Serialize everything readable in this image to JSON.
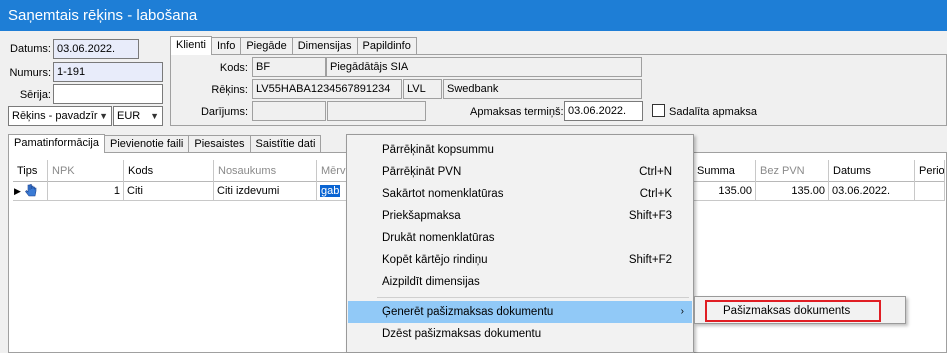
{
  "window": {
    "title": "Saņemtais rēķins - labošana"
  },
  "header": {
    "datums_label": "Datums:",
    "datums_value": "03.06.2022.",
    "numurs_label": "Numurs:",
    "numurs_value": "1-191",
    "serija_label": "Sērija:",
    "serija_value": "",
    "doc_type_value": "Rēķins - pavadzīr",
    "currency_value": "EUR"
  },
  "top_tabs": [
    "Klienti",
    "Info",
    "Piegāde",
    "Dimensijas",
    "Papildinfo"
  ],
  "klienti": {
    "kods_label": "Kods:",
    "kods_value": "BF",
    "kods_name": "Piegādātājs SIA",
    "rekins_label": "Rēķins:",
    "rekins_account": "LV55HABA1234567891234",
    "rekins_currency": "LVL",
    "rekins_bank": "Swedbank",
    "darijums_label": "Darījums:",
    "darijums_value": "",
    "darijums_extra": "",
    "apmaksas_label": "Apmaksas termiņš:",
    "apmaksas_value": "03.06.2022.",
    "sadalita_label": "Sadalīta apmaksa"
  },
  "bottom_tabs": [
    "Pamatinformācija",
    "Pievienotie faili",
    "Piesaistes",
    "Saistītie dati"
  ],
  "grid": {
    "columns": [
      "Tips",
      "NPK",
      "Kods",
      "Nosaukums",
      "Mērvi",
      "Summa",
      "Bez PVN",
      "Datums",
      "Period"
    ],
    "rows": [
      {
        "npk": "1",
        "kods": "Citi",
        "nosaukums": "Citi izdevumi",
        "mervieniba": "gab",
        "summa": "135.00",
        "bez_pvn": "135.00",
        "datums": "03.06.2022.",
        "periods": ""
      }
    ]
  },
  "context_menu": {
    "items": [
      {
        "label": "Pārrēķināt kopsummu",
        "shortcut": ""
      },
      {
        "label": "Pārrēķināt PVN",
        "shortcut": "Ctrl+N"
      },
      {
        "label": "Sakārtot nomenklatūras",
        "shortcut": "Ctrl+K"
      },
      {
        "label": "Priekšapmaksa",
        "shortcut": "Shift+F3"
      },
      {
        "label": "Drukāt nomenklatūras",
        "shortcut": ""
      },
      {
        "label": "Kopēt kārtējo rindiņu",
        "shortcut": "Shift+F2"
      },
      {
        "label": "Aizpildīt dimensijas",
        "shortcut": ""
      },
      {
        "label": "Ģenerēt pašizmaksas dokumentu",
        "shortcut": ""
      },
      {
        "label": "Dzēst pašizmaksas dokumentu",
        "shortcut": ""
      }
    ],
    "submenu_arrow": "›",
    "submenu_item": "Pašizmaksas dokuments"
  },
  "colors": {
    "titlebar": "#1e7ed6",
    "menu_highlight": "#91c9f7",
    "submenu_outline": "#e01e24",
    "selection": "#0a64d2"
  }
}
